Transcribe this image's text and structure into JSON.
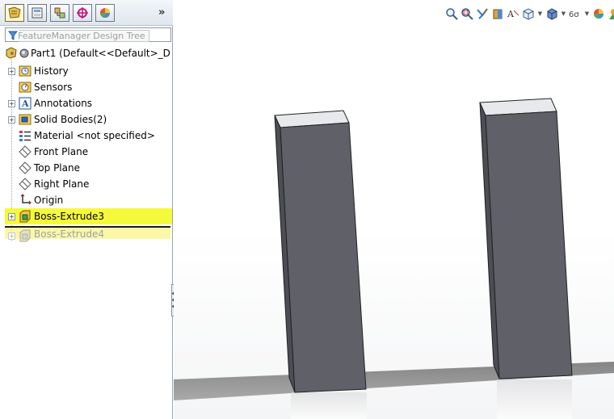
{
  "feature_manager": {
    "tabs": [
      "featuremanager-icon",
      "propertymanager-icon",
      "configurationmanager-icon",
      "dimxpert-icon",
      "display-manager-icon"
    ],
    "more_label": "»",
    "filter_tooltip": "FeatureManager Design Tree",
    "tree": {
      "root": "Part1  (Default<<Default>_D",
      "items": [
        {
          "label": "History",
          "icon": "history-icon"
        },
        {
          "label": "Sensors",
          "icon": "sensors-icon"
        },
        {
          "label": "Annotations",
          "icon": "annotations-icon"
        },
        {
          "label": "Solid Bodies(2)",
          "icon": "solid-bodies-icon"
        },
        {
          "label": "Material <not specified>",
          "icon": "material-icon"
        },
        {
          "label": "Front Plane",
          "icon": "plane-icon"
        },
        {
          "label": "Top Plane",
          "icon": "plane-icon"
        },
        {
          "label": "Right Plane",
          "icon": "plane-icon"
        },
        {
          "label": "Origin",
          "icon": "origin-icon"
        },
        {
          "label": "Boss-Extrude3",
          "icon": "boss-extrude-icon"
        },
        {
          "label": "Boss-Extrude4",
          "icon": "boss-extrude-icon"
        }
      ]
    }
  },
  "heads_up_toolbar": {
    "icons": [
      "zoom-to-fit-icon",
      "zoom-to-area-icon",
      "previous-view-icon",
      "section-view-icon",
      "dynamic-annotation-icon",
      "view-orientation-icon",
      "display-style-icon",
      "hide-show-items-icon",
      "edit-appearance-icon",
      "apply-scene-icon",
      "view-settings-icon"
    ]
  },
  "colors": {
    "highlight": "#f4fa3a",
    "body_side": "#5f6068",
    "body_top": "#e6e8ec"
  }
}
